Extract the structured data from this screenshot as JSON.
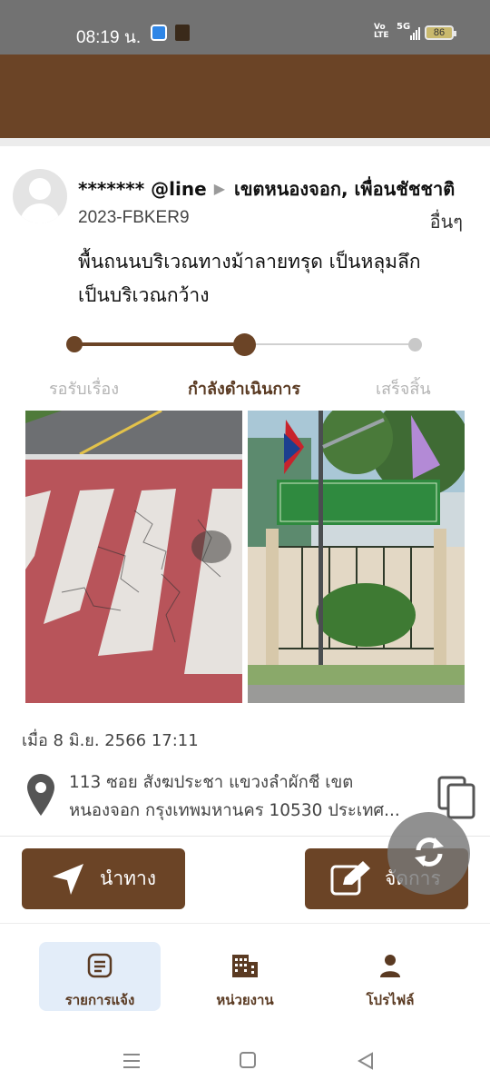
{
  "status_bar": {
    "time": "08:19 น.",
    "network_label": "Vo LTE",
    "signal_label": "5G",
    "battery": "86"
  },
  "report": {
    "reporter": "******* @line",
    "location": "เขตหนองจอก, เพื่อนชัชชาติ",
    "ticket_id": "2023-FBKER9",
    "category": "อื่นๆ",
    "description_line1": "พื้นถนนบริเวณทางม้าลายทรุด เป็นหลุมลึก",
    "description_line2": "เป็นบริเวณกว้าง",
    "date": "เมื่อ 8 มิ.ย. 2566 17:11",
    "address_line1": "113 ซอย สังฆประชา แขวงลำผักชี เขต",
    "address_line2": "หนองจอก กรุงเทพมหานคร 10530 ประเทศ..."
  },
  "progress": {
    "steps": [
      {
        "label": "รอรับเรื่อง",
        "state": "done"
      },
      {
        "label": "กำลังดำเนินการ",
        "state": "current"
      },
      {
        "label": "เสร็จสิ้น",
        "state": "pending"
      }
    ]
  },
  "photos": {
    "before": "cracked-crosswalk-photo",
    "after": "health-center-sign-photo"
  },
  "actions": {
    "navigate_label": "นำทาง",
    "manage_label": "จัดการ"
  },
  "tabs": [
    {
      "label": "รายการแจ้ง",
      "icon": "list-icon",
      "active": true
    },
    {
      "label": "หน่วยงาน",
      "icon": "building-icon",
      "active": false
    },
    {
      "label": "โปรไฟล์",
      "icon": "person-icon",
      "active": false
    }
  ],
  "colors": {
    "brand_brown": "#6b4426",
    "active_tab_bg": "#e3edf9",
    "inactive_step": "#b4b4b4"
  }
}
